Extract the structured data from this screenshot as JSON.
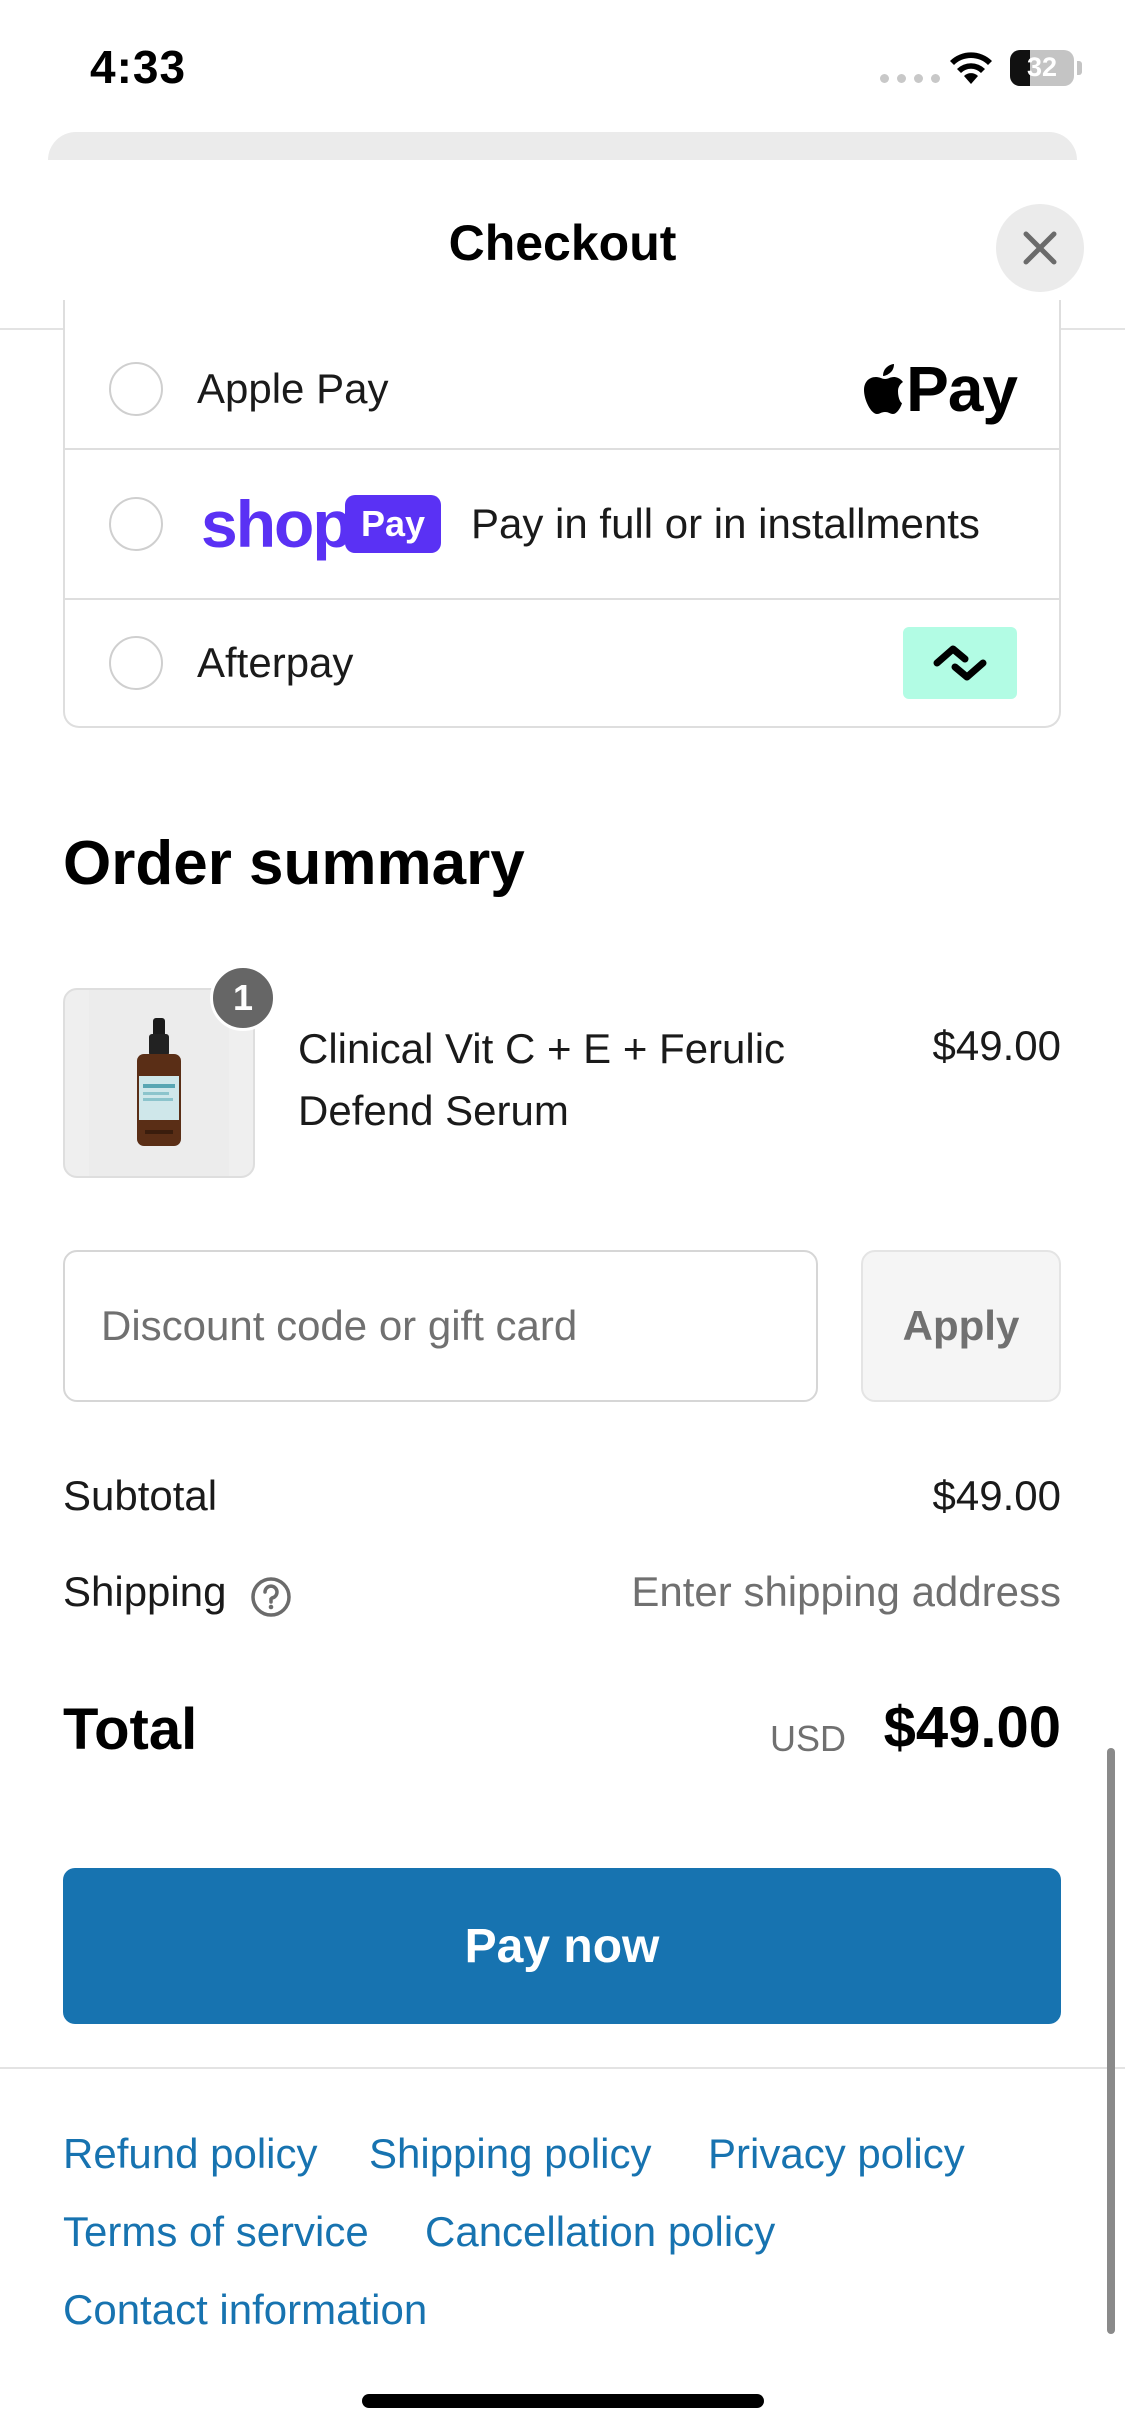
{
  "status_bar": {
    "time": "4:33",
    "battery": "32",
    "battery_level": 0.32
  },
  "header": {
    "title": "Checkout"
  },
  "payment_options": [
    {
      "label": "Apple Pay",
      "logo_text": "Pay"
    },
    {
      "logo_word": "shop",
      "logo_pill": "Pay",
      "label": "Pay in full or in installments"
    },
    {
      "label": "Afterpay"
    }
  ],
  "order_summary": {
    "title": "Order summary",
    "item": {
      "quantity": "1",
      "name": "Clinical Vit C + E + Ferulic Defend Serum",
      "price": "$49.00"
    },
    "discount": {
      "placeholder": "Discount code or gift card",
      "apply_label": "Apply"
    },
    "subtotal": {
      "label": "Subtotal",
      "value": "$49.00"
    },
    "shipping": {
      "label": "Shipping",
      "value": "Enter shipping address"
    },
    "total": {
      "label": "Total",
      "currency": "USD",
      "value": "$49.00"
    }
  },
  "pay_button": {
    "label": "Pay now"
  },
  "footer_links": {
    "refund": "Refund policy",
    "shipping": "Shipping policy",
    "privacy": "Privacy policy",
    "terms": "Terms of service",
    "cancellation": "Cancellation policy",
    "contact": "Contact information"
  },
  "colors": {
    "accent": "#1773b0",
    "shop_pay": "#5a31f4",
    "afterpay": "#b2fce4"
  }
}
